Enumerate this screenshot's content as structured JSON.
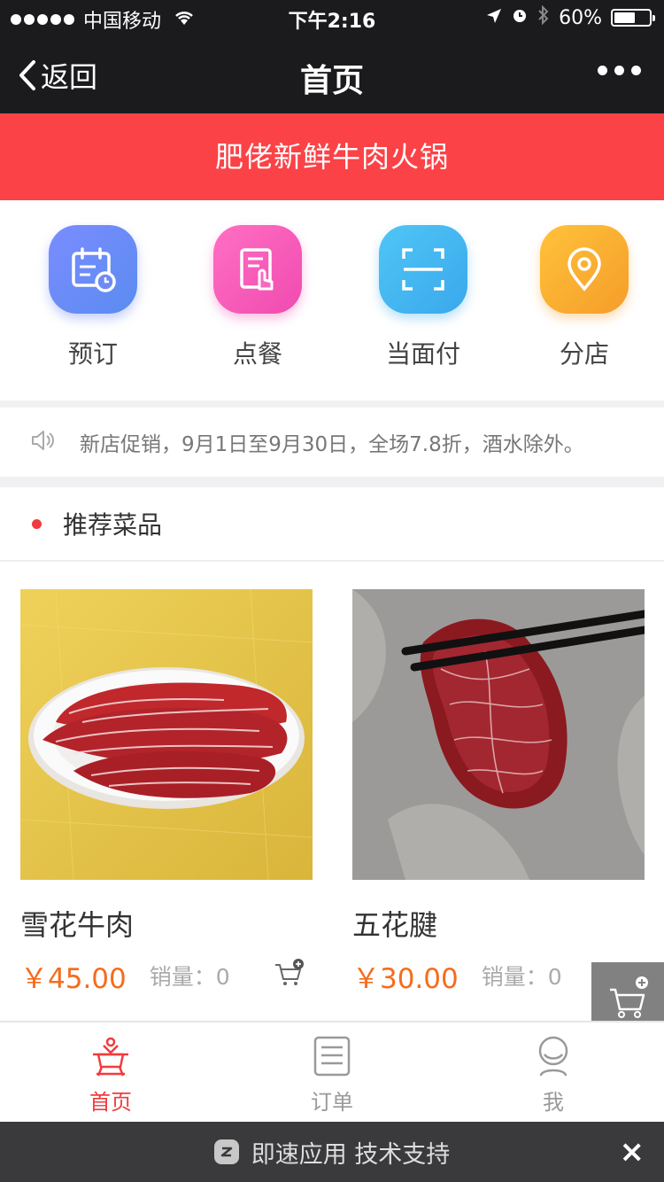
{
  "status_bar": {
    "carrier": "中国移动",
    "time": "下午2:16",
    "battery": "60%",
    "battery_level": 0.6
  },
  "nav": {
    "back_label": "返回",
    "title": "首页"
  },
  "banner": {
    "shop_name": "肥佬新鲜牛肉火锅"
  },
  "quick_actions": [
    {
      "label": "预订",
      "icon": "calendar-clock-icon"
    },
    {
      "label": "点餐",
      "icon": "menu-order-icon"
    },
    {
      "label": "当面付",
      "icon": "scan-pay-icon"
    },
    {
      "label": "分店",
      "icon": "location-pin-icon"
    }
  ],
  "notice": {
    "text": "新店促销，9月1日至9月30日，全场7.8折，酒水除外。"
  },
  "section": {
    "title": "推荐菜品"
  },
  "products": [
    {
      "name": "雪花牛肉",
      "price": "￥45.00",
      "sales_label": "销量：",
      "sales": "0"
    },
    {
      "name": "五花腱",
      "price": "￥30.00",
      "sales_label": "销量：",
      "sales": "0"
    }
  ],
  "tabs": [
    {
      "label": "首页",
      "icon": "hotpot-icon",
      "active": true
    },
    {
      "label": "订单",
      "icon": "order-list-icon",
      "active": false
    },
    {
      "label": "我",
      "icon": "user-icon",
      "active": false
    }
  ],
  "footer": {
    "support_text": "即速应用 技术支持",
    "close": "×"
  },
  "colors": {
    "brand_red": "#fb4347",
    "price_orange": "#f56c1d",
    "nav_dark": "#1b1b1d"
  }
}
